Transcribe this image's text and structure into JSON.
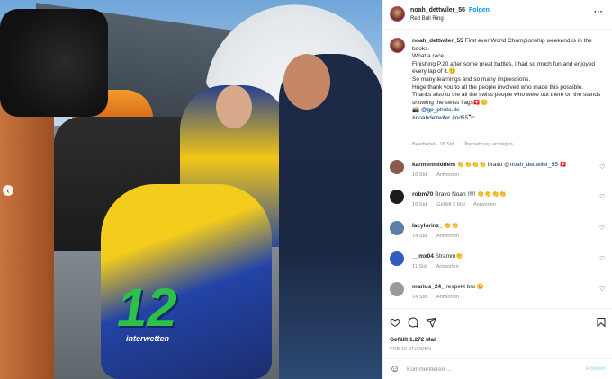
{
  "header": {
    "username": "noah_dettwiler_55",
    "separator": "•",
    "follow_label": "Folgen",
    "location": "Red Bull Ring",
    "more_label": "···"
  },
  "photo": {
    "bike_number": "12",
    "bike_brand": "interwetten",
    "prev_label": "‹"
  },
  "caption": {
    "username": "noah_dettwiler_55",
    "lines": [
      "First ever World Championship weekend is in the books.",
      "What a race…",
      "Finishing P.20 after some great battles. I had so much fun and enjoyed every lap of it.🙂",
      "So many learnings and so many impressions.",
      "Huge thank you to all the people involved who made this possible.",
      "Thanks also to the all the swiss people who were out there on the stands showing the swiss flags🇨🇭🙂"
    ],
    "photo_credit": "📸 @gp_photo.de",
    "hashtags": "#noahdettwiler #nd55🔭",
    "edited": "Bearbeitet · 16 Std.",
    "translation": "Übersetzung anzeigen"
  },
  "comments": [
    {
      "username": "karmenmiddem",
      "text": "👏👏👏👏 bravo",
      "mention": "@noah_dettwiler_55",
      "emoji": "🇨🇭",
      "time": "16 Std.",
      "likes": "",
      "reply": "Antworten",
      "avatar_color": "#8a5a4a"
    },
    {
      "username": "robm70",
      "text": "Bravo Noah !!!!! 👏👏👏👏",
      "mention": "",
      "emoji": "",
      "time": "16 Std.",
      "likes": "Gefällt 3 Mal",
      "reply": "Antworten",
      "avatar_color": "#1c1c1c"
    },
    {
      "username": "lacylorinz_",
      "text": "👏👏",
      "mention": "",
      "emoji": "",
      "time": "14 Std.",
      "likes": "",
      "reply": "Antworten",
      "avatar_color": "#5d7fa6"
    },
    {
      "username": "__mx04",
      "text": "Stramm👏",
      "mention": "",
      "emoji": "",
      "time": "11 Std.",
      "likes": "",
      "reply": "Antworten",
      "avatar_color": "#2f5cc0"
    },
    {
      "username": "marius_24_",
      "text": "respekt bro 😊",
      "mention": "",
      "emoji": "",
      "time": "14 Std.",
      "likes": "",
      "reply": "Antworten",
      "avatar_color": "#9a9a9a"
    }
  ],
  "actions": {
    "like_icon": "heart-icon",
    "comment_icon": "comment-icon",
    "share_icon": "share-icon",
    "save_icon": "bookmark-icon",
    "likes_text": "Gefällt 1.272 Mal",
    "time_ago": "VOR 16 STUNDEN"
  },
  "comment_bar": {
    "emoji_icon": "☺",
    "placeholder": "Kommentieren ...",
    "post_label": "Posten"
  }
}
